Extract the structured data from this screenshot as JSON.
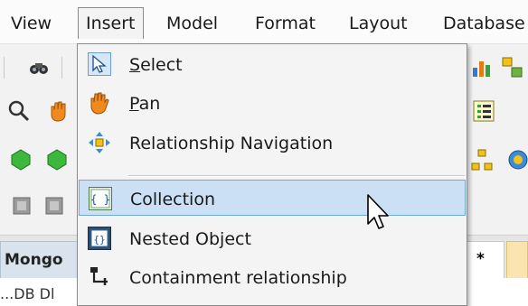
{
  "menubar": {
    "items": [
      "View",
      "Insert",
      "Model",
      "Format",
      "Layout",
      "Database"
    ]
  },
  "insert_menu": {
    "items": [
      {
        "prefix": "",
        "underline": "S",
        "rest": "elect",
        "icon": "select-arrow-icon"
      },
      {
        "prefix": "",
        "underline": "P",
        "rest": "an",
        "icon": "hand-pan-icon"
      },
      {
        "prefix": "Relationship Navigation",
        "underline": "",
        "rest": "",
        "icon": "navigation-arrows-icon"
      },
      {
        "prefix": "Collection",
        "underline": "",
        "rest": "",
        "icon": "collection-braces-icon"
      },
      {
        "prefix": "Nested Object",
        "underline": "",
        "rest": "",
        "icon": "nested-object-icon"
      },
      {
        "prefix": "Containment relationship",
        "underline": "",
        "rest": "",
        "icon": "containment-relationship-icon"
      }
    ]
  },
  "tabs": {
    "left": "Mongo",
    "right": "*"
  },
  "status": {
    "text": "...DB Dl"
  },
  "colors": {
    "highlight": "#cce0f5",
    "highlight_border": "#6ea8dc"
  }
}
